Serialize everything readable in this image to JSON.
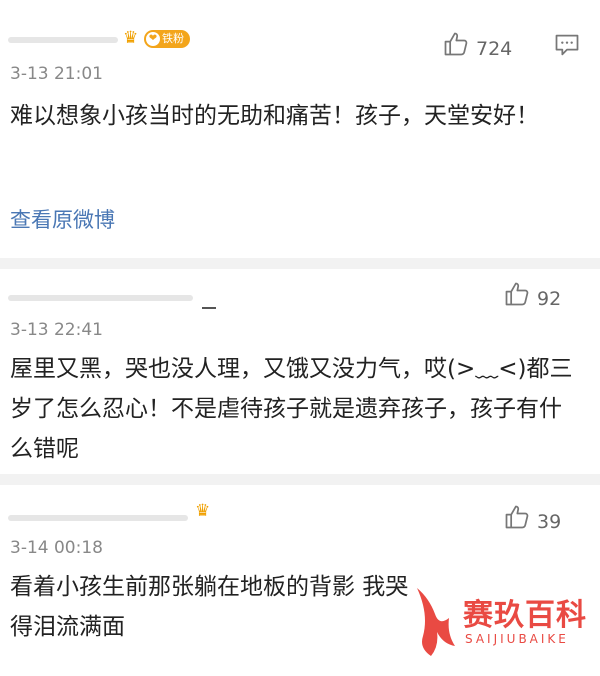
{
  "comments": [
    {
      "fan_badge": "铁粉",
      "time": "3-13 21:01",
      "likes": "724",
      "text": "难以想象小孩当时的无助和痛苦！孩子，天堂安好！",
      "link": "查看原微博"
    },
    {
      "time": "3-13 22:41",
      "likes": "92",
      "text": "屋里又黑，哭也没人理，又饿又没力气，哎(>﹏<)都三岁了怎么忍心！不是虐待孩子就是遗弃孩子，孩子有什么错呢"
    },
    {
      "time": "3-14 00:18",
      "likes": "39",
      "text": "看着小孩生前那张躺在地板的背影 我哭得泪流满面"
    }
  ],
  "watermark": {
    "title": "赛玖百科",
    "subtitle": "SAIJIUBAIKE"
  },
  "colors": {
    "link": "#4a77b4",
    "badge": "#f3a51b",
    "watermark": "#e94a43"
  },
  "icons": [
    "thumbs-up-icon",
    "comment-icon",
    "crown-icon",
    "watermark-logo-icon"
  ]
}
